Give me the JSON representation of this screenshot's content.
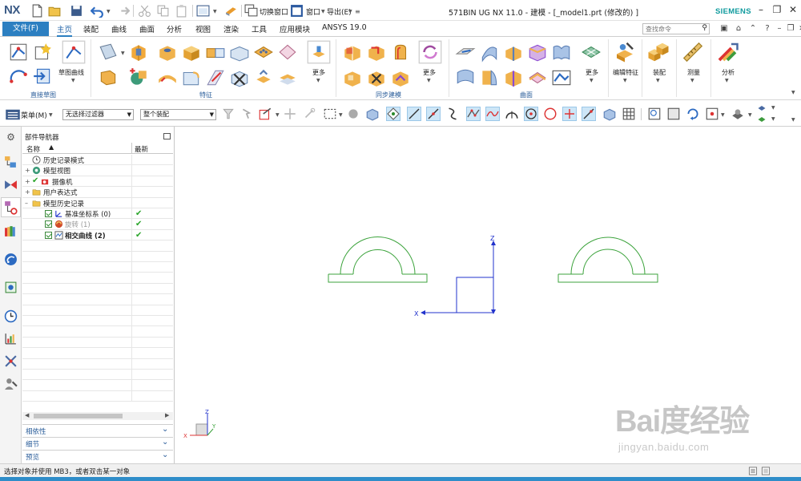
{
  "app": {
    "logo": "NX",
    "window_title": "571BIN UG NX 11.0 - 建模 - [_model1.prt  (修改的) ]",
    "brand": "SIEMENS",
    "quick_access": {
      "switch_window": "切换窗口",
      "window_menu": "窗口",
      "export_menu": "导出(E)"
    }
  },
  "menu": {
    "file_tab": "文件(F)",
    "tabs": [
      "主页",
      "装配",
      "曲线",
      "曲面",
      "分析",
      "视图",
      "渲染",
      "工具",
      "应用模块",
      "ANSYS 19.0"
    ],
    "active_tab": "主页",
    "command_search_placeholder": "查找命令"
  },
  "ribbon": {
    "groups": {
      "direct_sketch": "直接草图",
      "feature": "特征",
      "sync_modeling": "同步建模",
      "surface": "曲面"
    },
    "labels": {
      "sketch_curve": "草图曲线",
      "more1": "更多",
      "more2": "更多",
      "more3": "更多",
      "edit_feature": "编辑特征",
      "assembly": "装配",
      "measure": "测量",
      "analysis": "分析"
    }
  },
  "toolbar2": {
    "menu_button": "菜单(M)",
    "filter_combo": "无选择过滤器",
    "scope_combo": "整个装配"
  },
  "navigator": {
    "title": "部件导航器",
    "col_name": "名称",
    "col_latest": "最新",
    "rows": [
      {
        "label": "历史记录模式",
        "bold": false,
        "latest": false,
        "indent": 0
      },
      {
        "label": "模型视图",
        "bold": false,
        "latest": false,
        "indent": 0
      },
      {
        "label": "摄像机",
        "bold": false,
        "latest": false,
        "indent": 0
      },
      {
        "label": "用户表达式",
        "bold": false,
        "latest": false,
        "indent": 0
      },
      {
        "label": "模型历史记录",
        "bold": false,
        "latest": false,
        "indent": 0
      },
      {
        "label": "基准坐标系 (0)",
        "bold": false,
        "latest": true,
        "indent": 1
      },
      {
        "label": "旋转 (1)",
        "bold": false,
        "latest": true,
        "indent": 1
      },
      {
        "label": "相交曲线 (2)",
        "bold": true,
        "latest": true,
        "indent": 1
      }
    ],
    "panels": [
      "相依性",
      "细节",
      "预览"
    ]
  },
  "graphics": {
    "axis_z": "Z",
    "axis_x": "X",
    "triad_z": "Z",
    "triad_x": "X",
    "triad_y": "Y",
    "curve_color": "#3ca33c",
    "csys_color": "#2233cc"
  },
  "status": {
    "text": "选择对象并使用 MB3，或者双击某一对象"
  },
  "watermark": {
    "main": "Bai度经验",
    "url": "jingyan.baidu.com"
  },
  "colors": {
    "accent": "#2c7fc1",
    "status_bar": "#2f8dc9",
    "check_green": "#2aa52a"
  }
}
